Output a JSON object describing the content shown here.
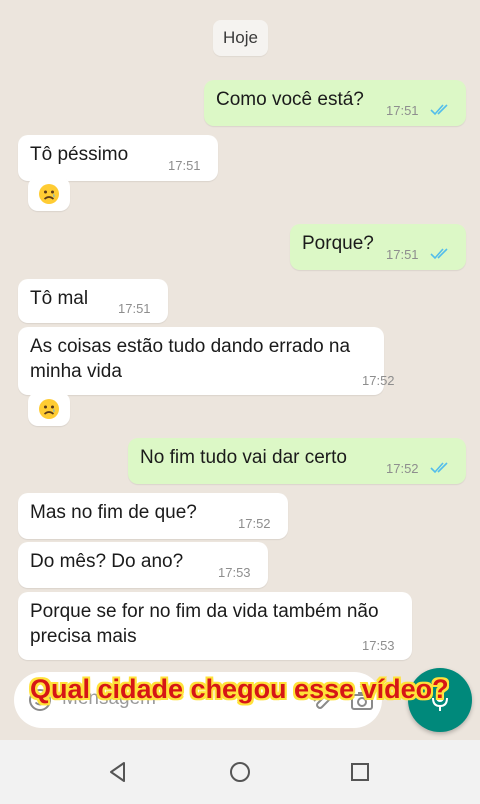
{
  "date_label": "Hoje",
  "messages": [
    {
      "direction": "out",
      "text": "Como você está?",
      "time": "17:51",
      "read": true
    },
    {
      "direction": "in",
      "text": "Tô péssimo",
      "time": "17:51"
    },
    {
      "direction": "in",
      "emoji": "sad-face"
    },
    {
      "direction": "out",
      "text": "Porque?",
      "time": "17:51",
      "read": true
    },
    {
      "direction": "in",
      "text": "Tô mal",
      "time": "17:51"
    },
    {
      "direction": "in",
      "text": "As coisas estão tudo dando errado na minha vida",
      "time": "17:52"
    },
    {
      "direction": "in",
      "emoji": "sad-face"
    },
    {
      "direction": "out",
      "text": "No fim tudo vai dar certo",
      "time": "17:52",
      "read": true
    },
    {
      "direction": "in",
      "text": "Mas no fim de que?",
      "time": "17:52"
    },
    {
      "direction": "in",
      "text": "Do mês? Do ano?",
      "time": "17:53"
    },
    {
      "direction": "in",
      "text": "Porque se for no fim da vida também não precisa mais",
      "time": "17:53"
    }
  ],
  "input": {
    "placeholder": "Mensagem"
  },
  "overlay_caption": "Qual cidade chegou esse vídeo?",
  "colors": {
    "background": "#ece5dd",
    "outgoing_bubble": "#dcf8c6",
    "incoming_bubble": "#ffffff",
    "read_ticks": "#53bdeb",
    "fab": "#00897b",
    "caption_text": "#d61616",
    "caption_outline": "#ffe23a"
  }
}
